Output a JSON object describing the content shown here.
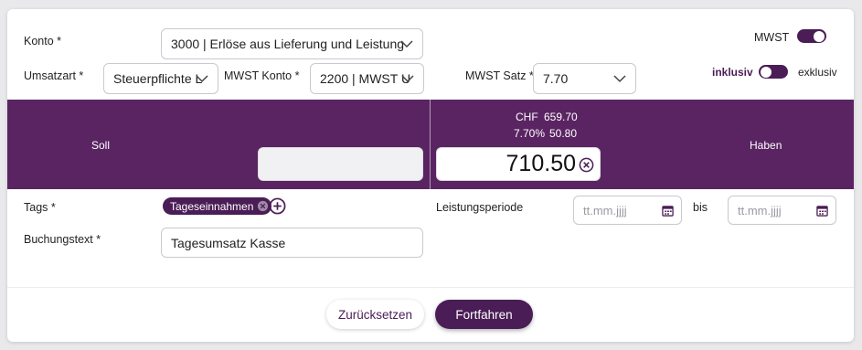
{
  "form": {
    "konto_label": "Konto *",
    "konto_value": "3000 | Erlöse aus Lieferung und Leistung",
    "umsatzart_label": "Umsatzart *",
    "umsatzart_value": "Steuerpflichte L",
    "mwst_konto_label": "MWST Konto *",
    "mwst_konto_value": "2200 | MWST U",
    "mwst_satz_label": "MWST Satz *",
    "mwst_satz_value": "7.70",
    "mwst_toggle_label": "MWST",
    "mwst_toggle_on": true,
    "inklusiv_label": "inklusiv",
    "exklusiv_label": "exklusiv"
  },
  "amount_band": {
    "soll_label": "Soll",
    "haben_label": "Haben",
    "chf_label": "CHF",
    "chf_value": "659.70",
    "tax_rate": "7.70%",
    "tax_value": "50.80",
    "amount_value": "710.50"
  },
  "details": {
    "tags_label": "Tags *",
    "tag_1": "Tageseinnahmen",
    "buchungstext_label": "Buchungstext *",
    "buchungstext_value": "Tagesumsatz Kasse",
    "leistungsperiode_label": "Leistungsperiode",
    "date_placeholder": "tt.mm.jjjj",
    "bis_label": "bis"
  },
  "actions": {
    "reset_label": "Zurücksetzen",
    "continue_label": "Fortfahren"
  },
  "colors": {
    "accent": "#4a1d56",
    "band": "#5a2463"
  }
}
